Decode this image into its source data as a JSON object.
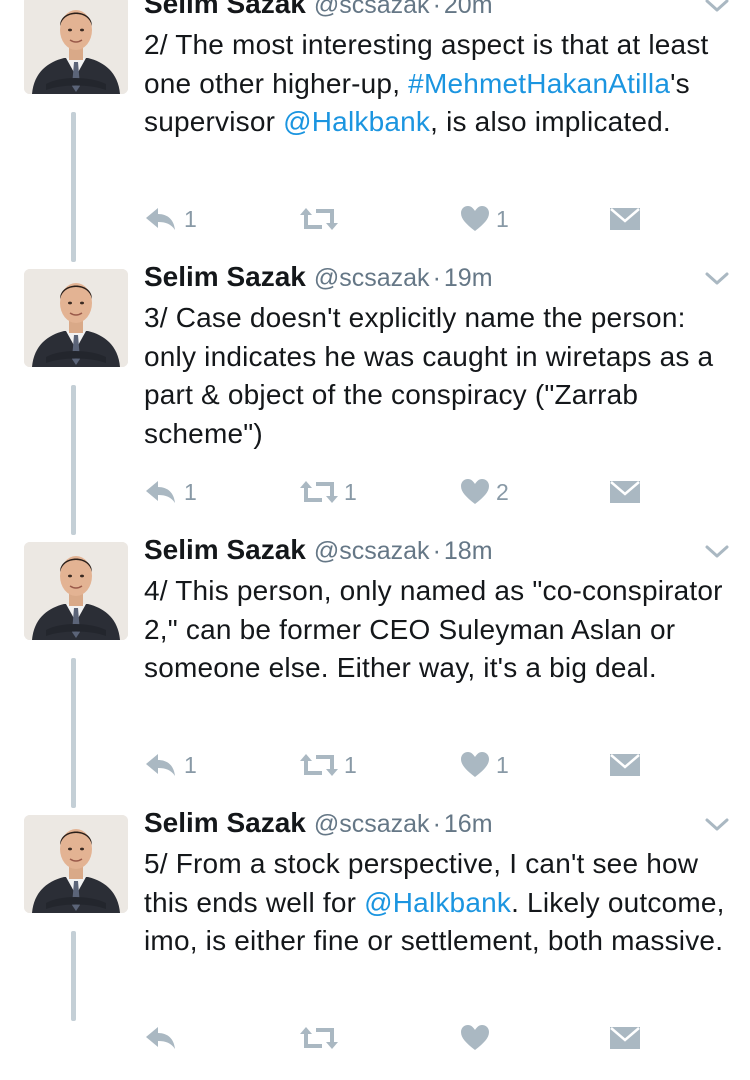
{
  "tweets": [
    {
      "name": "Selim Sazak",
      "handle": "@scsazak",
      "time": "20m",
      "text_parts": [
        {
          "t": "2/ The most interesting aspect is that at least one other higher-up, ",
          "link": false
        },
        {
          "t": "#MehmetHakanAtilla",
          "link": true
        },
        {
          "t": "'s supervisor ",
          "link": false
        },
        {
          "t": "@Halkbank",
          "link": true
        },
        {
          "t": ", is also implicated.",
          "link": false
        }
      ],
      "replies": "1",
      "retweets": "",
      "likes": "1"
    },
    {
      "name": "Selim Sazak",
      "handle": "@scsazak",
      "time": "19m",
      "text_parts": [
        {
          "t": "3/ Case doesn't explicitly name the person: only indicates he was caught in wiretaps as a part & object of the conspiracy (\"Zarrab scheme\")",
          "link": false
        }
      ],
      "replies": "1",
      "retweets": "1",
      "likes": "2"
    },
    {
      "name": "Selim Sazak",
      "handle": "@scsazak",
      "time": "18m",
      "text_parts": [
        {
          "t": "4/ This person, only named as \"co-conspirator 2,\" can be former CEO Suleyman Aslan or someone else. Either way, it's a big deal.",
          "link": false
        }
      ],
      "replies": "1",
      "retweets": "1",
      "likes": "1"
    },
    {
      "name": "Selim Sazak",
      "handle": "@scsazak",
      "time": "16m",
      "text_parts": [
        {
          "t": "5/ From a stock perspective, I can't see how this ends well for ",
          "link": false
        },
        {
          "t": "@Halkbank",
          "link": true
        },
        {
          "t": ". Likely outcome, imo, is either fine or settlement, both massive.",
          "link": false
        }
      ],
      "replies": "",
      "retweets": "",
      "likes": ""
    }
  ],
  "separator": "·",
  "colors": {
    "link": "#1b95e0",
    "muted": "#657786",
    "icon": "#aab8c2",
    "thread_line": "#c4cfd6"
  },
  "icons": [
    "reply-icon",
    "retweet-icon",
    "like-icon",
    "direct-message-icon",
    "caret-down-icon",
    "avatar-photo"
  ]
}
